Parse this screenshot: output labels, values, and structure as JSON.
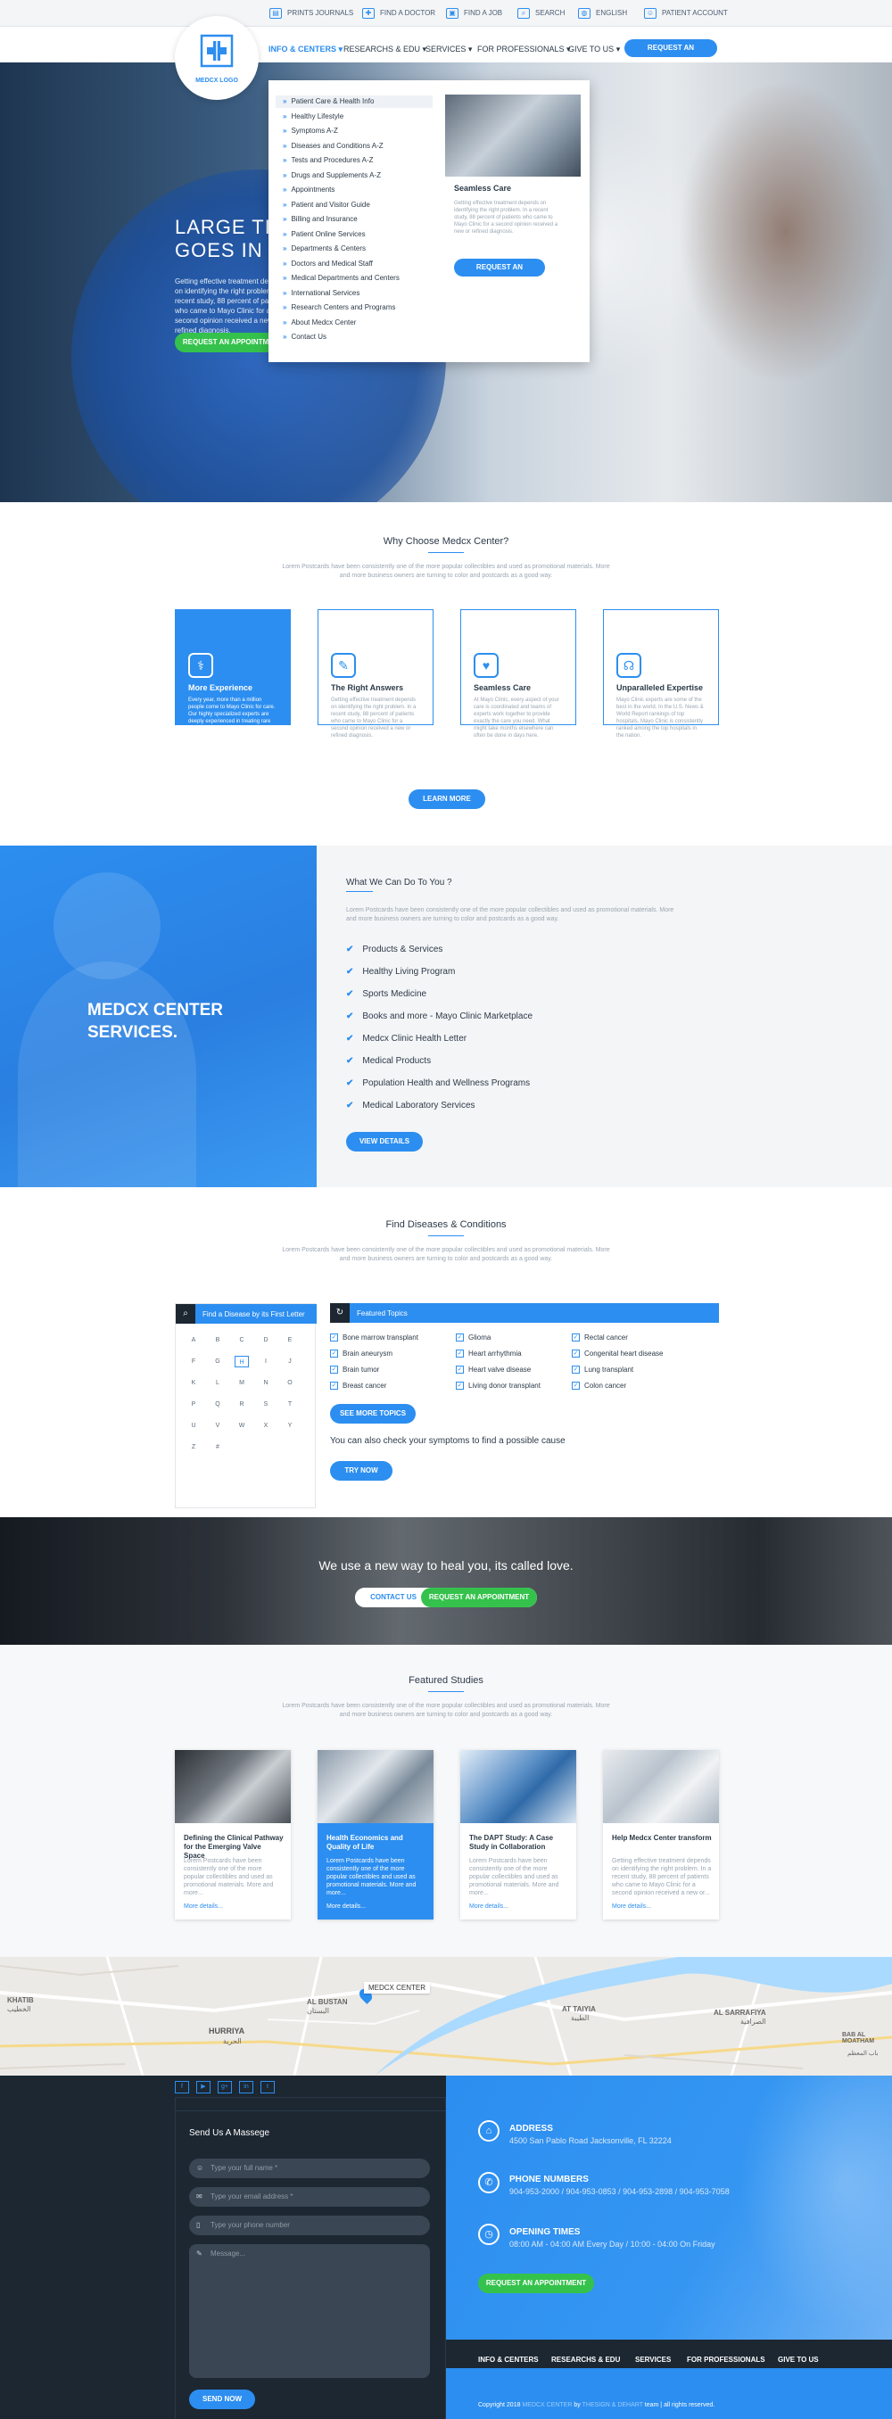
{
  "topbar": {
    "items": [
      {
        "icon": "journal-icon",
        "label": "Prints Journals"
      },
      {
        "icon": "doctor-icon",
        "label": "Find a Doctor"
      },
      {
        "icon": "job-icon",
        "label": "Find a Job"
      },
      {
        "icon": "search-icon",
        "label": "Search"
      },
      {
        "icon": "globe-icon",
        "label": "English"
      },
      {
        "icon": "user-icon",
        "label": "Patient Account"
      }
    ]
  },
  "logo": {
    "label": "MEDCX LOGO"
  },
  "nav": {
    "items": [
      "Info & Centers",
      "Researchs & Edu",
      "Services",
      "For Professionals",
      "Give To Us"
    ],
    "cta": "Request an Appointment"
  },
  "megamenu": {
    "items": [
      "Patient Care & Health Info",
      "Healthy Lifestyle",
      "Symptoms A-Z",
      "Diseases and Conditions A-Z",
      "Tests and Procedures A-Z",
      "Drugs and Supplements A-Z",
      "Appointments",
      "Patient and Visitor Guide",
      "Billing and Insurance",
      "Patient Online Services",
      "Departments & Centers",
      "Doctors and Medical Staff",
      "Medical Departments and Centers",
      "International Services",
      "Research Centers and Programs",
      "About Medcx Center",
      "Contact Us"
    ],
    "card": {
      "title": "Seamless Care",
      "text": "Getting effective treatment depends on identifying the right problem. In a recent study, 88 percent of patients who came to Mayo Clinic for a second opinion received a new or refined diagnosis.",
      "button": "Request an Appointment"
    }
  },
  "hero": {
    "title": "LARGE TITLE GOES IN THIS",
    "text": "Getting effective treatment depends on identifying the right problem. In a recent study, 88 percent of patients who came to Mayo Clinic for a second opinion received a new or refined diagnosis.",
    "button": "Request an Appointment"
  },
  "why": {
    "title": "Why Choose Medcx Center?",
    "subtitle": "Lorem Postcards have been consistently one of the more popular collectibles and used as promotional materials. More and more business owners are turning to color and postcards as a good way.",
    "cards": [
      {
        "icon": "doctor-icon",
        "title": "More Experience",
        "text": "Every year, more than a million people come to Mayo Clinic for care. Our highly specialized experts are deeply experienced in treating rare and complex conditions."
      },
      {
        "icon": "clipboard-icon",
        "title": "The Right Answers",
        "text": "Getting effective treatment depends on identifying the right problem. In a recent study, 88 percent of patients who came to Mayo Clinic for a second opinion received a new or refined diagnosis."
      },
      {
        "icon": "care-icon",
        "title": "Seamless Care",
        "text": "At Mayo Clinic, every aspect of your care is coordinated and teams of experts work together to provide exactly the care you need. What might take months elsewhere can often be done in days here."
      },
      {
        "icon": "stethoscope-icon",
        "title": "Unparalleled Expertise",
        "text": "Mayo Clinic experts are some of the best in the world. In the U.S. News & World Report rankings of top hospitals, Mayo Clinic is consistently ranked among the top hospitals in the nation."
      }
    ],
    "button": "Learn More"
  },
  "services": {
    "left_title": "MEDCX CENTER SERVICES.",
    "title": "What We Can Do To You ?",
    "subtitle": "Lorem Postcards have been consistently one of the more popular collectibles and used as promotional materials. More and more business owners are turning to color and postcards as a good way.",
    "items": [
      "Products & Services",
      "Healthy Living Program",
      "Sports Medicine",
      "Books and more - Mayo Clinic Marketplace",
      "Medcx Clinic Health Letter",
      "Medical Products",
      "Population Health and Wellness Programs",
      "Medical Laboratory Services"
    ],
    "button": "View Details"
  },
  "diseases": {
    "title": "Find Diseases & Conditions",
    "subtitle": "Lorem Postcards have been consistently one of the more popular collectibles and used as promotional materials. More and more business owners are turning to color and postcards as a good way.",
    "letter_header": "Find a Disease by its First Letter",
    "letters": [
      "A",
      "B",
      "C",
      "D",
      "E",
      "F",
      "G",
      "H",
      "I",
      "J",
      "K",
      "L",
      "M",
      "N",
      "O",
      "P",
      "Q",
      "R",
      "S",
      "T",
      "U",
      "V",
      "W",
      "X",
      "Y",
      "Z",
      "#"
    ],
    "topics_header": "Featured Topics",
    "topics": [
      "Bone marrow transplant",
      "Glioma",
      "Rectal cancer",
      "Brain aneurysm",
      "Heart arrhythmia",
      "Congenital heart disease",
      "Brain tumor",
      "Heart valve disease",
      "Lung transplant",
      "Breast cancer",
      "Living donor transplant",
      "Colon cancer"
    ],
    "more_button": "See More Topics",
    "symptom_text": "You can also check your symptoms to find a possible cause",
    "try_button": "Try Now"
  },
  "banner": {
    "text": "We use a new way to heal you, its called love.",
    "contact": "Contact Us",
    "appointment": "Request an Appointment"
  },
  "studies": {
    "title": "Featured Studies",
    "subtitle": "Lorem Postcards have been consistently one of the more popular collectibles and used as promotional materials. More and more business owners are turning to color and postcards as a good way.",
    "cards": [
      {
        "title": "Defining the Clinical Pathway for the Emerging Valve Space",
        "text": "Lorem Postcards have been consistently one of the more popular collectibles and used as promotional materials. More and more...",
        "more": "More details..."
      },
      {
        "title": "Health Economics and Quality of Life",
        "text": "Lorem Postcards have been consistently one of the more popular collectibles and used as promotional materials. More and more...",
        "more": "More details..."
      },
      {
        "title": "The DAPT Study: A Case Study in Collaboration",
        "text": "Lorem Postcards have been consistently one of the more popular collectibles and used as promotional materials. More and more...",
        "more": "More details..."
      },
      {
        "title": "Help Medcx Center transform",
        "text": "Getting effective treatment depends on identifying the right problem. In a recent study, 88 percent of patients who came to Mayo Clinic for a second opinion received a new or...",
        "more": "More details..."
      }
    ]
  },
  "map": {
    "marker": "MEDCX CENTER",
    "labels": [
      "KHATIB",
      "AL BUSTAN",
      "HURRIYA",
      "AT TAIYIA",
      "AL SARRAFIYA",
      "BAB AL MOATHAM"
    ],
    "arabic_labels": [
      "الخطيب",
      "البستان",
      "الحرية",
      "الطيبة",
      "الصرافية",
      "باب المعظم"
    ]
  },
  "footer": {
    "social": [
      "f",
      "▶",
      "g+",
      "in",
      "t"
    ],
    "form_title": "Send Us A Massege",
    "name_placeholder": "Type your full name *",
    "email_placeholder": "Type your email address *",
    "phone_placeholder": "Type your phone number",
    "message_placeholder": "Message...",
    "send_button": "Send Now",
    "address_label": "Address",
    "address_value": "4500 San Pablo Road Jacksonville, FL 32224",
    "phone_label": "Phone Numbers",
    "phone_value": "904-953-2000 / 904-953-0853 / 904-953-2898 / 904-953-7058",
    "hours_label": "Opening Times",
    "hours_value": "08:00 AM - 04:00 AM Every Day / 10:00 - 04:00 On Friday",
    "cta": "Request an Appointment",
    "nav": [
      "Info & Centers",
      "Researchs & Edu",
      "Services",
      "For Professionals",
      "Give To Us"
    ],
    "copyright_a": "Copyright 2018",
    "copyright_b": "MEDCX CENTER",
    "copyright_c": "by",
    "copyright_d": "THESIGN & DEHART",
    "copyright_e": "team | all rights reserved."
  },
  "colors": {
    "accent": "#2c8ef0",
    "green": "#35c24c",
    "footer_dark": "#1c2732"
  }
}
